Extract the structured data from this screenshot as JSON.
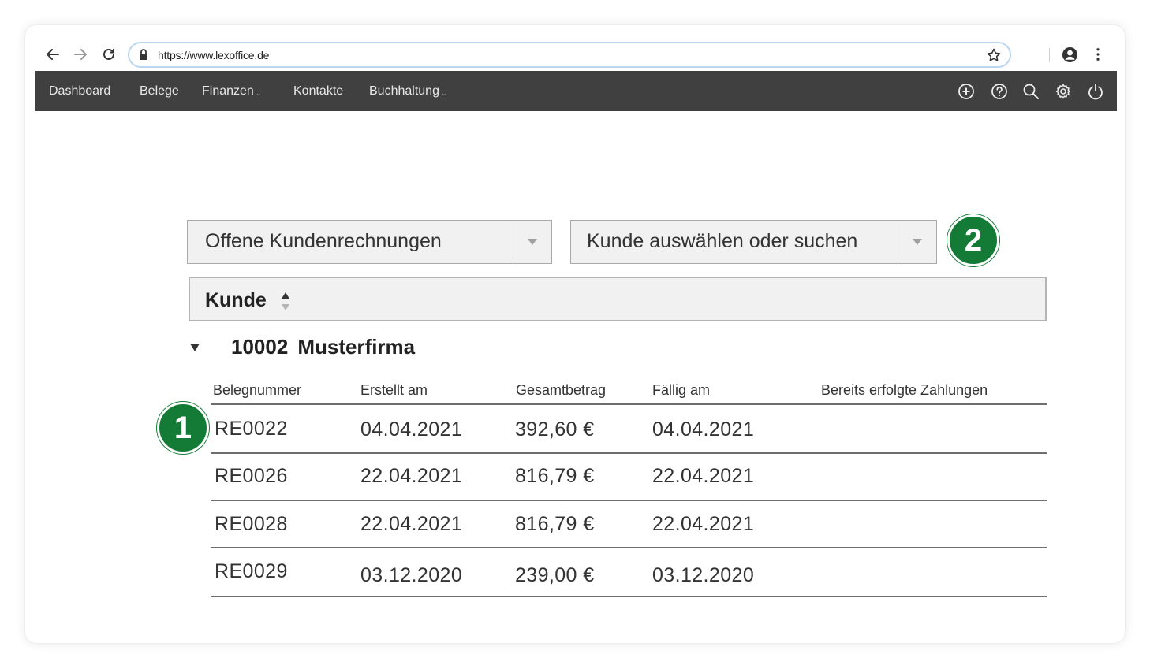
{
  "browser": {
    "url": "https://www.lexoffice.de"
  },
  "nav": {
    "items": [
      {
        "label": "Dashboard",
        "dropdown": false
      },
      {
        "label": "Belege",
        "dropdown": false
      },
      {
        "label": "Finanzen",
        "dropdown": true
      },
      {
        "label": "Kontakte",
        "dropdown": false
      },
      {
        "label": "Buchhaltung",
        "dropdown": true
      }
    ],
    "tools": [
      "add-circle-icon",
      "help-circle-icon",
      "search-icon",
      "settings-gear-icon",
      "power-icon"
    ]
  },
  "filters": {
    "invoice_type": "Offene Kundenrechnungen",
    "customer": "Kunde auswählen oder suchen"
  },
  "sort": {
    "label": "Kunde"
  },
  "group": {
    "number": "10002",
    "name": "Musterfirma"
  },
  "table": {
    "headers": [
      "Belegnummer",
      "Erstellt am",
      "Gesamtbetrag",
      "Fällig am",
      "Bereits erfolgte Zahlungen"
    ],
    "rows": [
      {
        "number": "RE0022",
        "created": "04.04.2021",
        "total": "392,60 €",
        "due": "04.04.2021",
        "paid": ""
      },
      {
        "number": "RE0026",
        "created": "22.04.2021",
        "total": "816,79 €",
        "due": "22.04.2021",
        "paid": ""
      },
      {
        "number": "RE0028",
        "created": "22.04.2021",
        "total": "816,79 €",
        "due": "22.04.2021",
        "paid": ""
      },
      {
        "number": "RE0029",
        "created": "03.12.2020",
        "total": "239,00 €",
        "due": "03.12.2020",
        "paid": ""
      }
    ]
  },
  "badges": [
    "1",
    "2"
  ],
  "colors": {
    "appbar": "#404040",
    "badge": "#137b35",
    "urlbar_border": "#bcd6f0"
  }
}
